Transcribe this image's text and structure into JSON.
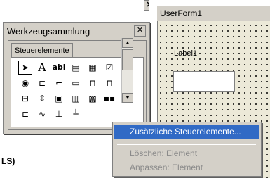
{
  "document": {
    "partial_text": "LS)"
  },
  "userform": {
    "title": "UserForm1",
    "label": "Label1"
  },
  "toolbox": {
    "title": "Werkzeugsammlung",
    "tab": "Steuerelemente",
    "tools": [
      {
        "name": "pointer-icon",
        "glyph": "➤"
      },
      {
        "name": "label-icon",
        "glyph": "A"
      },
      {
        "name": "textbox-icon",
        "glyph": "abl"
      },
      {
        "name": "combobox-icon",
        "glyph": "▤"
      },
      {
        "name": "listbox-icon",
        "glyph": "▦"
      },
      {
        "name": "checkbox-icon",
        "glyph": "☑"
      },
      {
        "name": "optionbutton-icon",
        "glyph": "◉"
      },
      {
        "name": "togglebutton-icon",
        "glyph": "⊏"
      },
      {
        "name": "frame-icon",
        "glyph": "⌐"
      },
      {
        "name": "commandbutton-icon",
        "glyph": "▭"
      },
      {
        "name": "tabstrip-icon",
        "glyph": "⊓"
      },
      {
        "name": "multipage-icon",
        "glyph": "⊓"
      },
      {
        "name": "scrollbar-icon",
        "glyph": "⊟"
      },
      {
        "name": "spinbutton-icon",
        "glyph": "⇕"
      },
      {
        "name": "image-icon",
        "glyph": "▣"
      },
      {
        "name": "refedit-icon",
        "glyph": "▥"
      },
      {
        "name": "grid-icon",
        "glyph": "▩"
      },
      {
        "name": "dots-icon",
        "glyph": "▪▪"
      },
      {
        "name": "extra-1-icon",
        "glyph": "⊏"
      },
      {
        "name": "extra-2-icon",
        "glyph": "∿"
      },
      {
        "name": "extra-3-icon",
        "glyph": "⊥"
      },
      {
        "name": "extra-4-icon",
        "glyph": "╧"
      }
    ]
  },
  "context_menu": {
    "items": [
      {
        "label": "Zusätzliche Steuerelemente...",
        "state": "highlighted"
      },
      {
        "label": "Löschen: Element",
        "state": "disabled"
      },
      {
        "label": "Anpassen: Element",
        "state": "disabled"
      }
    ]
  },
  "colors": {
    "highlight": "#316ac5",
    "face": "#d4d0c8",
    "disabled": "#8a8a8a"
  }
}
